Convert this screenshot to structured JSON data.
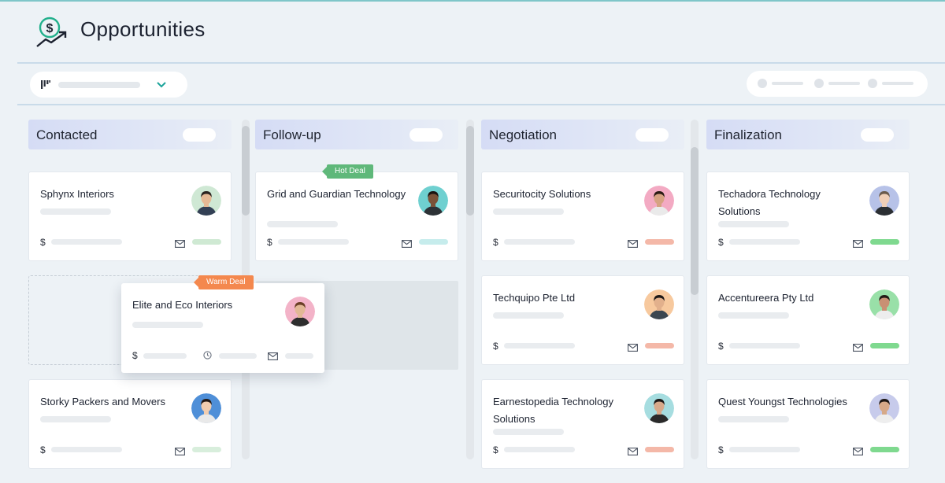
{
  "header": {
    "title": "Opportunities",
    "icon": "dollar-growth-icon"
  },
  "toolbar": {
    "filter_icon": "filter-icon",
    "dropdown_icon": "chevron-down-icon"
  },
  "columns": [
    {
      "title": "Contacted",
      "cards": [
        {
          "name": "Sphynx Interiors",
          "status_color": "#cfe9d3",
          "avatar_bg": "#cfe8d4",
          "skin": "#e5b995",
          "hair": "#2b2420",
          "shirt": "#334055"
        },
        {
          "name": "Storky Packers and Movers",
          "status_color": "#d8eedc",
          "avatar_bg": "#4f8fd8",
          "skin": "#f1cdb0",
          "hair": "#241a16",
          "shirt": "#e9e9e9"
        }
      ]
    },
    {
      "title": "Follow-up",
      "cards": [
        {
          "name": "Grid and Guardian Technology",
          "tag": "Hot Deal",
          "status_color": "#c6ecec",
          "avatar_bg": "#6fd0d0",
          "skin": "#7a5238",
          "hair": "#1a1412",
          "shirt": "#2d3236"
        }
      ]
    },
    {
      "title": "Negotiation",
      "cards": [
        {
          "name": "Securitocity Solutions",
          "status_color": "#f4b8a8",
          "avatar_bg": "#f3aac3",
          "skin": "#d6a282",
          "hair": "#2a1b14",
          "shirt": "#eaeaea"
        },
        {
          "name": "Techquipo Pte Ltd",
          "status_color": "#f4b8a8",
          "avatar_bg": "#f7c99e",
          "skin": "#e2b08c",
          "hair": "#1e1816",
          "shirt": "#3b4650"
        },
        {
          "name": "Earnestopedia Technology Solutions",
          "status_color": "#f4b8a8",
          "avatar_bg": "#a6dde0",
          "skin": "#d8a98a",
          "hair": "#1e1816",
          "shirt": "#2a2a2a"
        }
      ]
    },
    {
      "title": "Finalization",
      "cards": [
        {
          "name": "Techadora Technology Solutions",
          "status_color": "#7fd98f",
          "avatar_bg": "#b7c2e8",
          "skin": "#f0cfb7",
          "hair": "#6a5a4c",
          "shirt": "#2b2f33"
        },
        {
          "name": "Accentureera Pty Ltd",
          "status_color": "#7fd98f",
          "avatar_bg": "#99e0a8",
          "skin": "#c99073",
          "hair": "#231a15",
          "shirt": "#ededed"
        },
        {
          "name": "Quest Youngst Technologies",
          "status_color": "#7fd98f",
          "avatar_bg": "#c7cbeb",
          "skin": "#d6a988",
          "hair": "#1d1714",
          "shirt": "#eeeeee"
        }
      ]
    }
  ],
  "dragging_card": {
    "name": "Elite and Eco Interiors",
    "tag": "Warm Deal",
    "avatar_bg": "#f3b3c8",
    "skin": "#e2b896",
    "hair": "#6b3f26",
    "shirt": "#2e2e2e"
  },
  "currency_symbol": "$",
  "colors": {
    "accent": "#1aa39a",
    "hot_deal": "#5fb87a",
    "warm_deal": "#f4884e"
  }
}
